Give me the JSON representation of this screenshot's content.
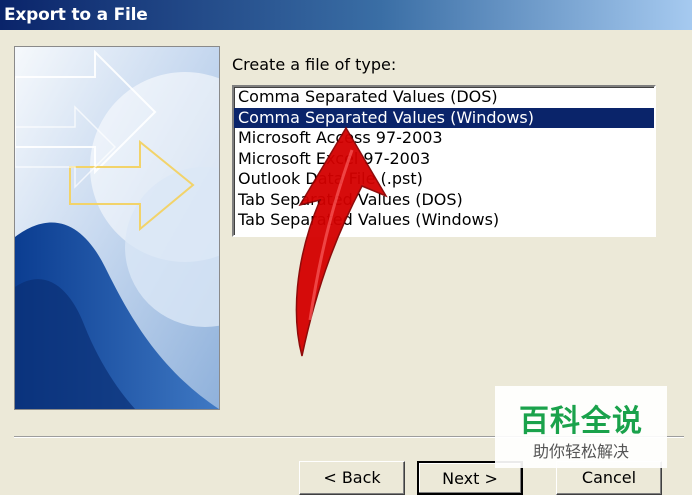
{
  "window": {
    "title": "Export to a File"
  },
  "dialog": {
    "prompt": "Create a file of type:",
    "file_types": [
      "Comma Separated Values (DOS)",
      "Comma Separated Values (Windows)",
      "Microsoft Access 97-2003",
      "Microsoft Excel 97-2003",
      "Outlook Data File (.pst)",
      "Tab Separated Values (DOS)",
      "Tab Separated Values (Windows)"
    ],
    "selected_index": 1
  },
  "buttons": {
    "back": "< Back",
    "next": "Next >",
    "cancel": "Cancel"
  },
  "watermark": {
    "main": "百科全说",
    "sub": "助你轻松解决"
  },
  "colors": {
    "selection": "#0a246a",
    "annotation_arrow": "#d40000",
    "watermark_green": "#1aa24b"
  }
}
